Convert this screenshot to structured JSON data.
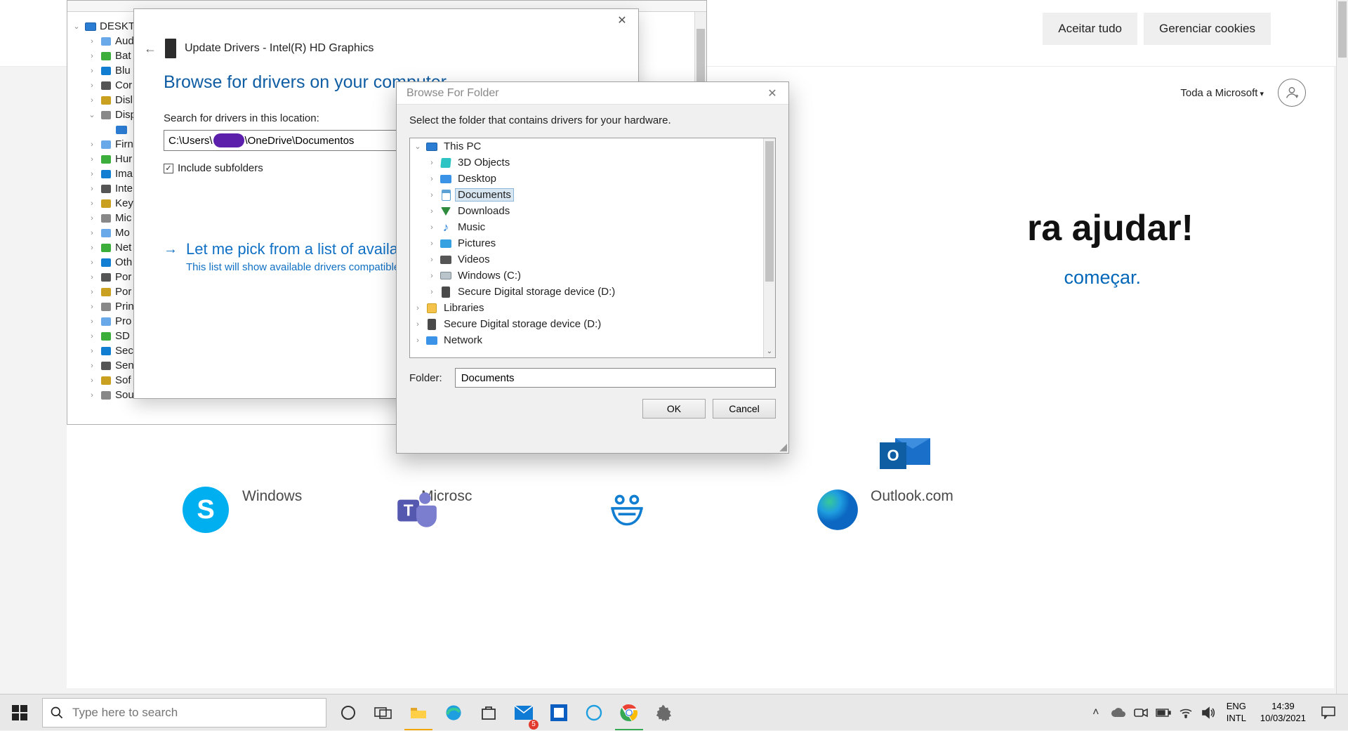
{
  "browser": {
    "accept": "Aceitar tudo",
    "manage": "Gerenciar cookies",
    "all_ms": "Toda a Microsoft",
    "h1_frag": "ra ajudar!",
    "h2_frag": "começar.",
    "windows_label": "Windows",
    "micros_label": "Microsc",
    "outlook_label": "Outlook.com"
  },
  "devmgr": {
    "root": "DESKTO",
    "kids": [
      "Aud",
      "Bat",
      "Blu",
      "Cor",
      "Disl",
      "Disp",
      "Firn",
      "Hur",
      "Ima",
      "Inte",
      "Key",
      "Mic",
      "Mo",
      "Net",
      "Oth",
      "Por",
      "Por",
      "Prin",
      "Pro",
      "SD I",
      "Sec",
      "Sen",
      "Sof",
      "Sou"
    ]
  },
  "wizard": {
    "title": "Update Drivers - Intel(R) HD Graphics",
    "heading": "Browse for drivers on your computer",
    "search_label": "Search for drivers in this location:",
    "path_prefix": "C:\\Users\\",
    "path_suffix": "\\OneDrive\\Documentos",
    "include": "Include subfolders",
    "alt_title": "Let me pick from a list of available dr",
    "alt_desc": "This list will show available drivers compatible wit                         category as the device."
  },
  "bff": {
    "title": "Browse For Folder",
    "msg": "Select the folder that contains drivers for your hardware.",
    "tree": {
      "root": "This PC",
      "kids": [
        "3D Objects",
        "Desktop",
        "Documents",
        "Downloads",
        "Music",
        "Pictures",
        "Videos",
        "Windows (C:)",
        "Secure Digital storage device (D:)"
      ],
      "siblings": [
        "Libraries",
        "Secure Digital storage device (D:)",
        "Network"
      ]
    },
    "folder_label": "Folder:",
    "folder_value": "Documents",
    "ok": "OK",
    "cancel": "Cancel"
  },
  "taskbar": {
    "search_placeholder": "Type here to search",
    "lang1": "ENG",
    "lang2": "INTL",
    "time": "14:39",
    "date": "10/03/2021",
    "mail_badge": "5"
  }
}
